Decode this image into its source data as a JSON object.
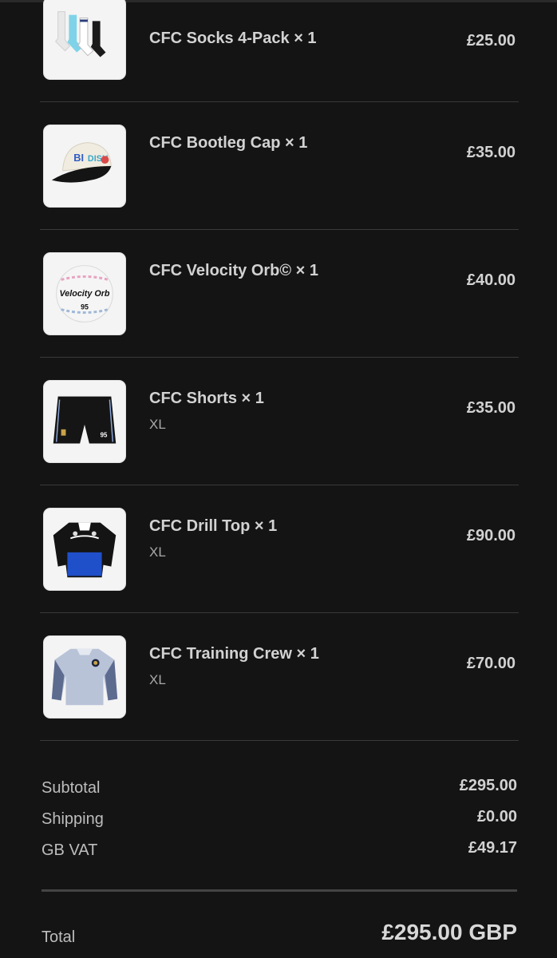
{
  "items": [
    {
      "name": "CFC Socks 4-Pack × 1",
      "variant": "",
      "price": "£25.00",
      "icon": "socks-thumbnail"
    },
    {
      "name": "CFC Bootleg Cap × 1",
      "variant": "",
      "price": "£35.00",
      "icon": "cap-thumbnail"
    },
    {
      "name": "CFC Velocity Orb© × 1",
      "variant": "",
      "price": "£40.00",
      "icon": "ball-thumbnail"
    },
    {
      "name": "CFC Shorts × 1",
      "variant": "XL",
      "price": "£35.00",
      "icon": "shorts-thumbnail"
    },
    {
      "name": "CFC Drill Top × 1",
      "variant": "XL",
      "price": "£90.00",
      "icon": "drill-top-thumbnail"
    },
    {
      "name": "CFC Training Crew × 1",
      "variant": "XL",
      "price": "£70.00",
      "icon": "sweatshirt-thumbnail"
    }
  ],
  "summary": {
    "subtotal_label": "Subtotal",
    "subtotal_value": "£295.00",
    "shipping_label": "Shipping",
    "shipping_value": "£0.00",
    "vat_label": "GB VAT",
    "vat_value": "£49.17"
  },
  "total": {
    "label": "Total",
    "value": "£295.00 GBP"
  },
  "thumb_text": {
    "ball_brand": "Velocity Orb",
    "ball_number": "95",
    "shorts_number": "95"
  },
  "colors": {
    "background": "#141414",
    "divider": "#3a3a3a",
    "text": "#d2d2d2",
    "muted": "#bdbdbd"
  }
}
